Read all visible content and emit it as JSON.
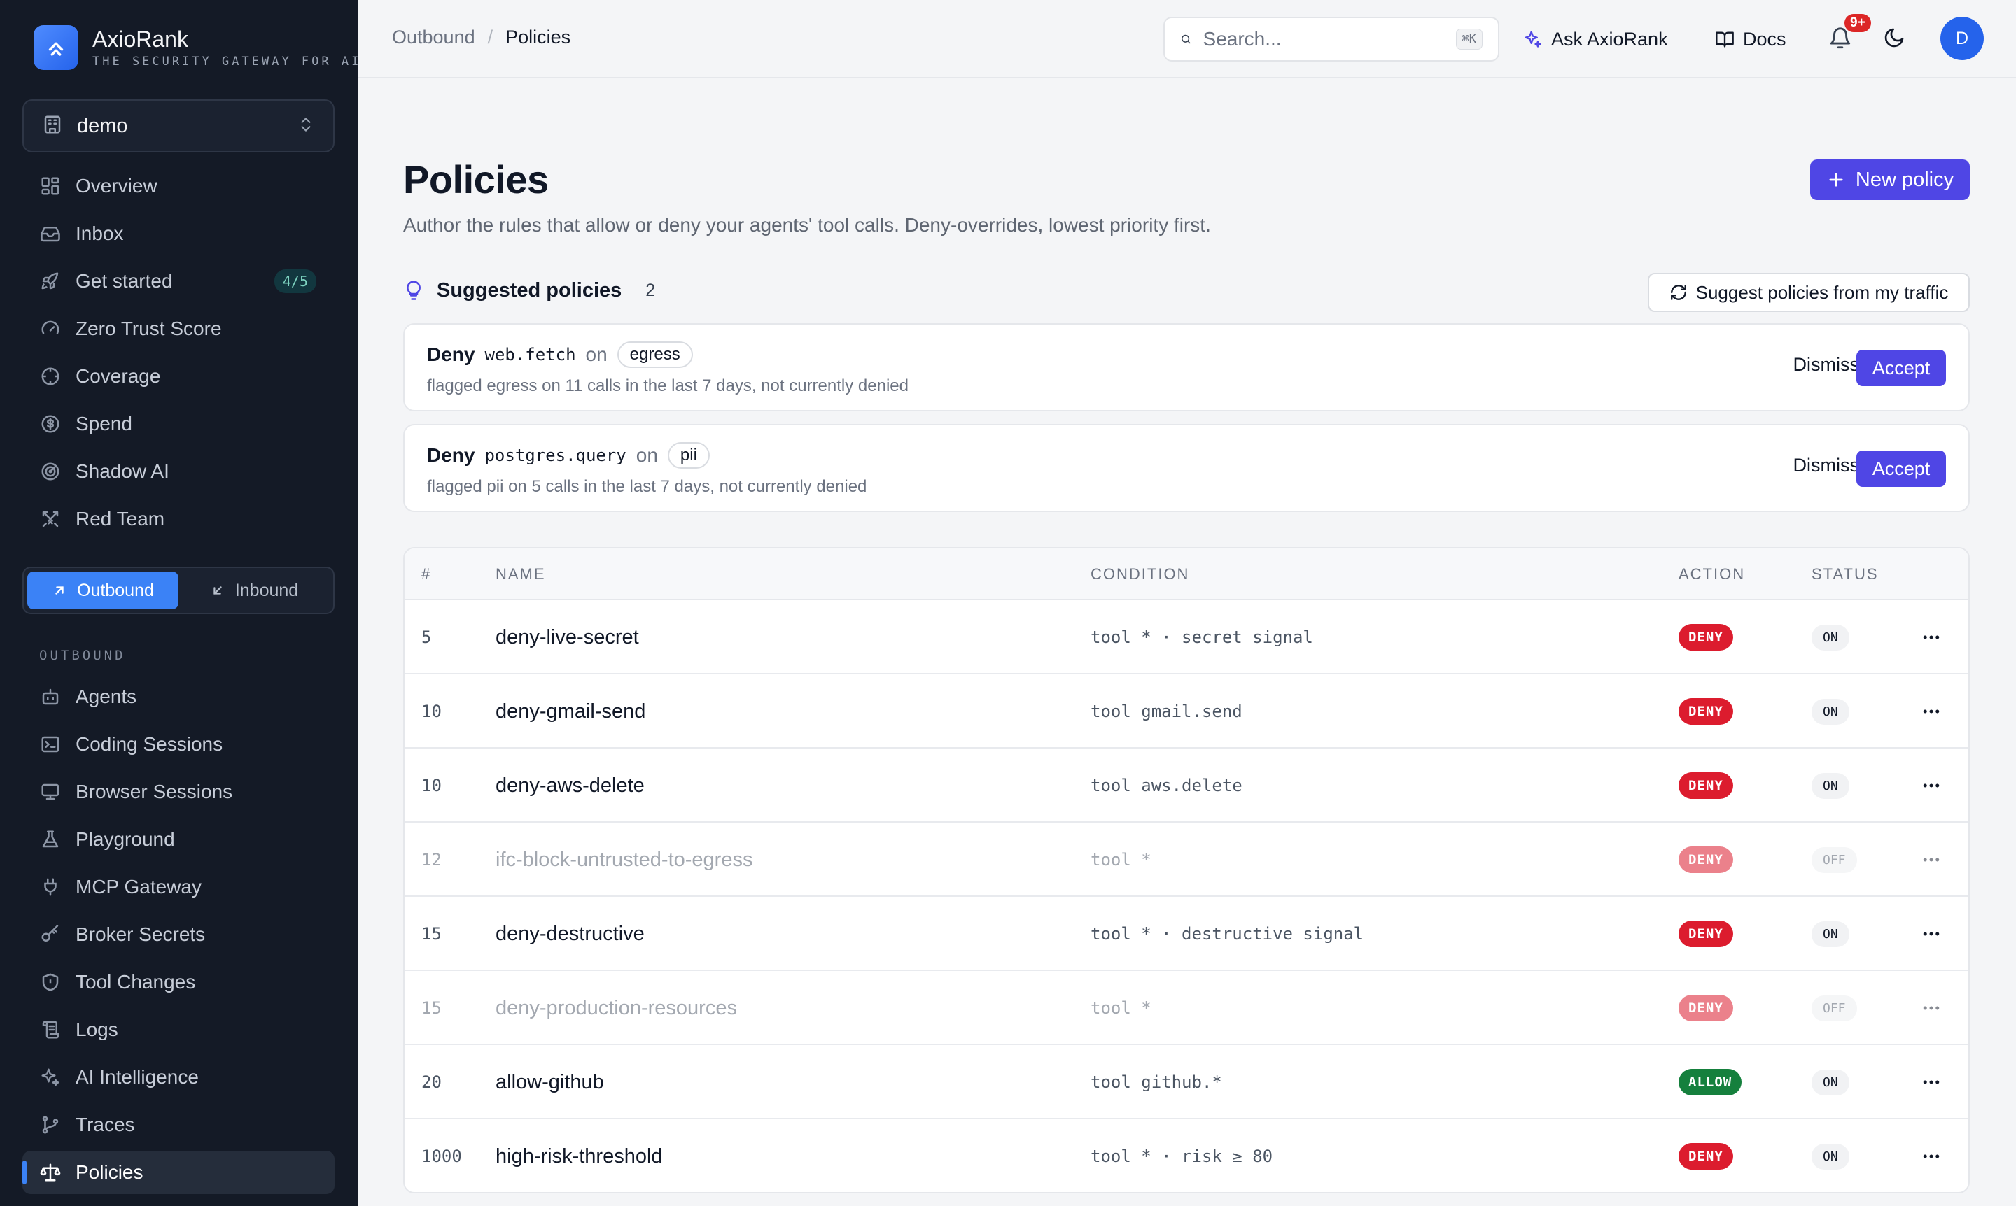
{
  "brand": {
    "name": "AxioRank",
    "tagline": "THE SECURITY GATEWAY FOR AI AG"
  },
  "org": {
    "selected": "demo"
  },
  "nav_primary": [
    {
      "label": "Overview",
      "icon": "grid-icon"
    },
    {
      "label": "Inbox",
      "icon": "inbox-icon"
    },
    {
      "label": "Get started",
      "icon": "rocket-icon",
      "badge": "4/5"
    },
    {
      "label": "Zero Trust Score",
      "icon": "gauge-icon"
    },
    {
      "label": "Coverage",
      "icon": "target-icon"
    },
    {
      "label": "Spend",
      "icon": "dollar-icon"
    },
    {
      "label": "Shadow AI",
      "icon": "radar-icon"
    },
    {
      "label": "Red Team",
      "icon": "swords-icon"
    }
  ],
  "direction": {
    "outbound": "Outbound",
    "inbound": "Inbound",
    "selected": "Outbound"
  },
  "section_label": "OUTBOUND",
  "nav_outbound": [
    {
      "label": "Agents",
      "icon": "bot-icon"
    },
    {
      "label": "Coding Sessions",
      "icon": "terminal-icon"
    },
    {
      "label": "Browser Sessions",
      "icon": "monitor-icon"
    },
    {
      "label": "Playground",
      "icon": "flask-icon"
    },
    {
      "label": "MCP Gateway",
      "icon": "plug-icon"
    },
    {
      "label": "Broker Secrets",
      "icon": "key-icon"
    },
    {
      "label": "Tool Changes",
      "icon": "shield-icon"
    },
    {
      "label": "Logs",
      "icon": "scroll-icon"
    },
    {
      "label": "AI Intelligence",
      "icon": "sparkles-icon"
    },
    {
      "label": "Traces",
      "icon": "git-branch-icon"
    },
    {
      "label": "Policies",
      "icon": "scale-icon",
      "active": true
    }
  ],
  "breadcrumb": {
    "parent": "Outbound",
    "current": "Policies"
  },
  "search": {
    "placeholder": "Search...",
    "shortcut": "⌘K"
  },
  "topbar": {
    "ask": "Ask AxioRank",
    "docs": "Docs",
    "notifications": "9+",
    "avatar": "D"
  },
  "page": {
    "title": "Policies",
    "subtitle": "Author the rules that allow or deny your agents' tool calls. Deny-overrides, lowest priority first.",
    "new_button": "New policy"
  },
  "suggested": {
    "title": "Suggested policies",
    "count": "2",
    "suggest_button": "Suggest policies from my traffic",
    "items": [
      {
        "verb": "Deny",
        "tool": "web.fetch",
        "on": "on",
        "tag": "egress",
        "detail": "flagged egress on 11 calls in the last 7 days, not currently denied",
        "dismiss": "Dismiss",
        "accept": "Accept"
      },
      {
        "verb": "Deny",
        "tool": "postgres.query",
        "on": "on",
        "tag": "pii",
        "detail": "flagged pii on 5 calls in the last 7 days, not currently denied",
        "dismiss": "Dismiss",
        "accept": "Accept"
      }
    ]
  },
  "table": {
    "headers": {
      "num": "#",
      "name": "NAME",
      "condition": "CONDITION",
      "action": "ACTION",
      "status": "STATUS"
    },
    "rows": [
      {
        "priority": "5",
        "name": "deny-live-secret",
        "condition": "tool * · secret signal",
        "action": "DENY",
        "status": "ON"
      },
      {
        "priority": "10",
        "name": "deny-gmail-send",
        "condition": "tool gmail.send",
        "action": "DENY",
        "status": "ON"
      },
      {
        "priority": "10",
        "name": "deny-aws-delete",
        "condition": "tool aws.delete",
        "action": "DENY",
        "status": "ON"
      },
      {
        "priority": "12",
        "name": "ifc-block-untrusted-to-egress",
        "condition": "tool *",
        "action": "DENY",
        "status": "OFF"
      },
      {
        "priority": "15",
        "name": "deny-destructive",
        "condition": "tool * · destructive signal",
        "action": "DENY",
        "status": "ON"
      },
      {
        "priority": "15",
        "name": "deny-production-resources",
        "condition": "tool *",
        "action": "DENY",
        "status": "OFF"
      },
      {
        "priority": "20",
        "name": "allow-github",
        "condition": "tool github.*",
        "action": "ALLOW",
        "status": "ON"
      },
      {
        "priority": "1000",
        "name": "high-risk-threshold",
        "condition": "tool * · risk ≥ 80",
        "action": "DENY",
        "status": "ON"
      }
    ]
  }
}
